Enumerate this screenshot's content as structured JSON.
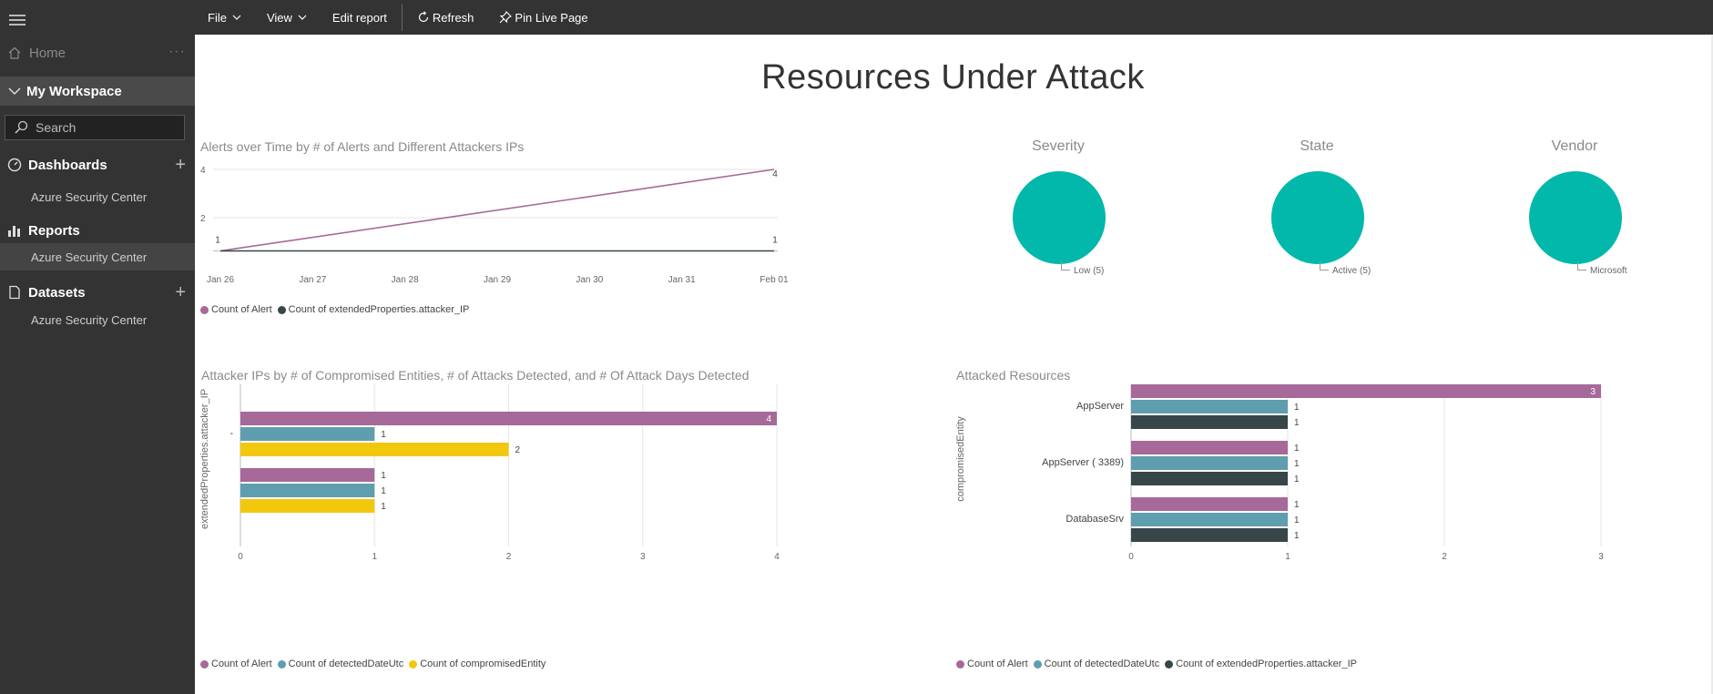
{
  "sidebar": {
    "home_label": "Home",
    "workspace_label": "My Workspace",
    "search_placeholder": "Search",
    "sections": [
      {
        "label": "Dashboards",
        "items": [
          "Azure Security Center"
        ]
      },
      {
        "label": "Reports",
        "items": [
          "Azure Security Center"
        ]
      },
      {
        "label": "Datasets",
        "items": [
          "Azure Security Center"
        ]
      }
    ]
  },
  "toolbar": {
    "file": "File",
    "view": "View",
    "edit_report": "Edit report",
    "refresh": "Refresh",
    "pin_live_page": "Pin Live Page"
  },
  "report": {
    "title": "Resources Under Attack"
  },
  "colors": {
    "purple": "#a66999",
    "teal": "#5f9eae",
    "dark": "#374649",
    "yellow": "#f2c80f",
    "pie": "#01b8aa"
  },
  "pies": [
    {
      "title": "Severity",
      "label": "Low (5)"
    },
    {
      "title": "State",
      "label": "Active (5)"
    },
    {
      "title": "Vendor",
      "label": "Microsoft"
    }
  ],
  "chart_data": [
    {
      "type": "line",
      "title": "Alerts over Time by # of Alerts and Different Attackers IPs",
      "x": [
        "Jan 26",
        "Jan 27",
        "Jan 28",
        "Jan 29",
        "Jan 30",
        "Jan 31",
        "Feb 01"
      ],
      "y_ticks": [
        2,
        4
      ],
      "ylim": [
        0,
        4
      ],
      "series": [
        {
          "name": "Count of Alert",
          "color": "#a66999",
          "points": [
            {
              "x": "Jan 26",
              "y": 1
            },
            {
              "x": "Feb 01",
              "y": 4
            }
          ],
          "labels": [
            "1",
            "4"
          ]
        },
        {
          "name": "Count of extendedProperties.attacker_IP",
          "color": "#374649",
          "points": [
            {
              "x": "Jan 26",
              "y": 1
            },
            {
              "x": "Feb 01",
              "y": 1
            }
          ],
          "labels": [
            "1",
            "1"
          ]
        }
      ],
      "grid": true,
      "legend": "bottom-left"
    },
    {
      "type": "bar",
      "orientation": "horizontal",
      "title": "Attacker IPs by # of Compromised Entities, # of Attacks Detected, and # Of Attack Days Detected",
      "ylabel": "extendedProperties.attacker_IP",
      "categories": [
        "-",
        ""
      ],
      "x_ticks": [
        0,
        1,
        2,
        3,
        4
      ],
      "xlim": [
        0,
        4
      ],
      "series": [
        {
          "name": "Count of Alert",
          "color": "#a66999",
          "values": [
            4,
            1
          ]
        },
        {
          "name": "Count of detectedDateUtc",
          "color": "#5f9eae",
          "values": [
            1,
            1
          ]
        },
        {
          "name": "Count of compromisedEntity",
          "color": "#f2c80f",
          "values": [
            2,
            1
          ]
        }
      ],
      "legend": "bottom-left"
    },
    {
      "type": "bar",
      "orientation": "horizontal",
      "title": "Attacked Resources",
      "ylabel": "compromisedEntity",
      "categories": [
        "AppServer",
        "AppServer (",
        "DatabaseSrv"
      ],
      "category_suffix": [
        "",
        "3389)",
        ""
      ],
      "x_ticks": [
        0,
        1,
        2,
        3
      ],
      "xlim": [
        0,
        3
      ],
      "series": [
        {
          "name": "Count of Alert",
          "color": "#a66999",
          "values": [
            3,
            1,
            1
          ]
        },
        {
          "name": "Count of detectedDateUtc",
          "color": "#5f9eae",
          "values": [
            1,
            1,
            1
          ]
        },
        {
          "name": "Count of extendedProperties.attacker_IP",
          "color": "#374649",
          "values": [
            1,
            1,
            1
          ]
        }
      ],
      "legend": "bottom-left"
    }
  ]
}
